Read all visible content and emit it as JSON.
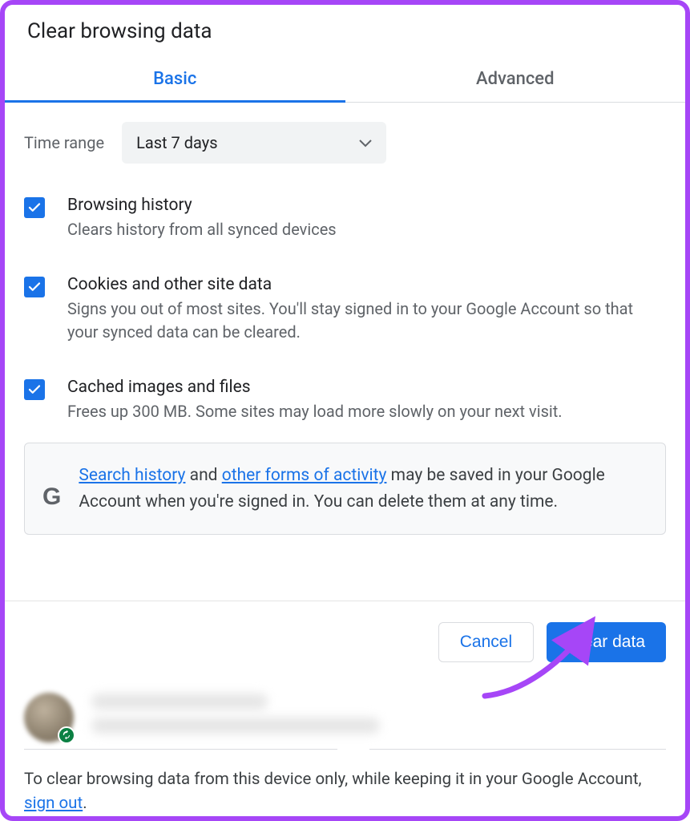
{
  "dialog": {
    "title": "Clear browsing data",
    "tabs": {
      "basic": "Basic",
      "advanced": "Advanced"
    },
    "timerange": {
      "label": "Time range",
      "selected": "Last 7 days"
    },
    "options": {
      "history": {
        "title": "Browsing history",
        "desc": "Clears history from all synced devices",
        "checked": true
      },
      "cookies": {
        "title": "Cookies and other site data",
        "desc": "Signs you out of most sites. You'll stay signed in to your Google Account so that your synced data can be cleared.",
        "checked": true
      },
      "cache": {
        "title": "Cached images and files",
        "desc": "Frees up 300 MB. Some sites may load more slowly on your next visit.",
        "checked": true
      }
    },
    "info": {
      "link1": "Search history",
      "mid1": " and ",
      "link2": "other forms of activity",
      "rest": " may be saved in your Google Account when you're signed in. You can delete them at any time."
    },
    "buttons": {
      "cancel": "Cancel",
      "clear": "Clear data"
    },
    "footer": {
      "text1": "To clear browsing data from this device only, while keeping it in your Google Account, ",
      "link": "sign out",
      "text2": "."
    }
  }
}
